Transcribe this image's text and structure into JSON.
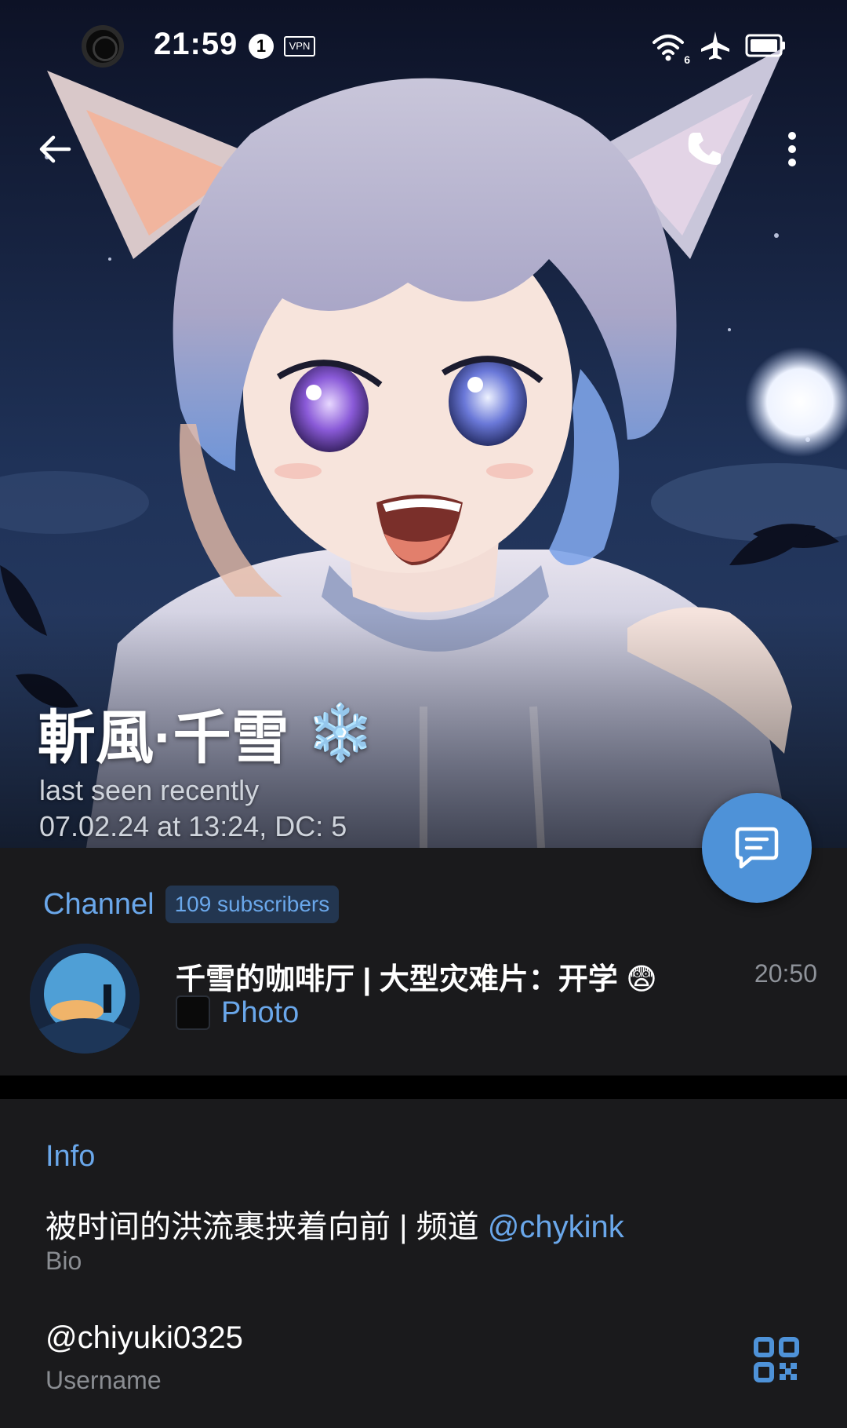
{
  "status_bar": {
    "time": "21:59",
    "notification_count": "1",
    "vpn_label": "VPN",
    "wifi_badge": "6",
    "icons": [
      "record-icon",
      "notification-badge-icon",
      "vpn-icon",
      "wifi-icon",
      "airplane-icon",
      "battery-icon"
    ]
  },
  "top_bar": {
    "icons": [
      "back-arrow-icon",
      "phone-icon",
      "more-vertical-icon"
    ]
  },
  "profile": {
    "name": "斬風·千雪",
    "name_emoji": "❄️",
    "status": "last seen recently",
    "registration": "07.02.24 at 13:24, DC: 5"
  },
  "fab": {
    "icon": "message-icon"
  },
  "channel": {
    "section_title": "Channel",
    "subscribers": "109 subscribers",
    "name": "千雪的咖啡厅 | 大型灾难片：开学 😨",
    "time": "20:50",
    "last_message": "Photo"
  },
  "info": {
    "section_title": "Info",
    "bio_text": "被时间的洪流裹挟着向前 | 频道 ",
    "bio_link": "@chykink",
    "bio_label": "Bio",
    "username": "@chiyuki0325",
    "username_label": "Username",
    "qr_icon": "qr-code-icon"
  },
  "colors": {
    "accent": "#6aa7ea",
    "fab": "#4e92d8",
    "card_bg": "#1a1a1c",
    "secondary_text": "#8a8d92"
  }
}
